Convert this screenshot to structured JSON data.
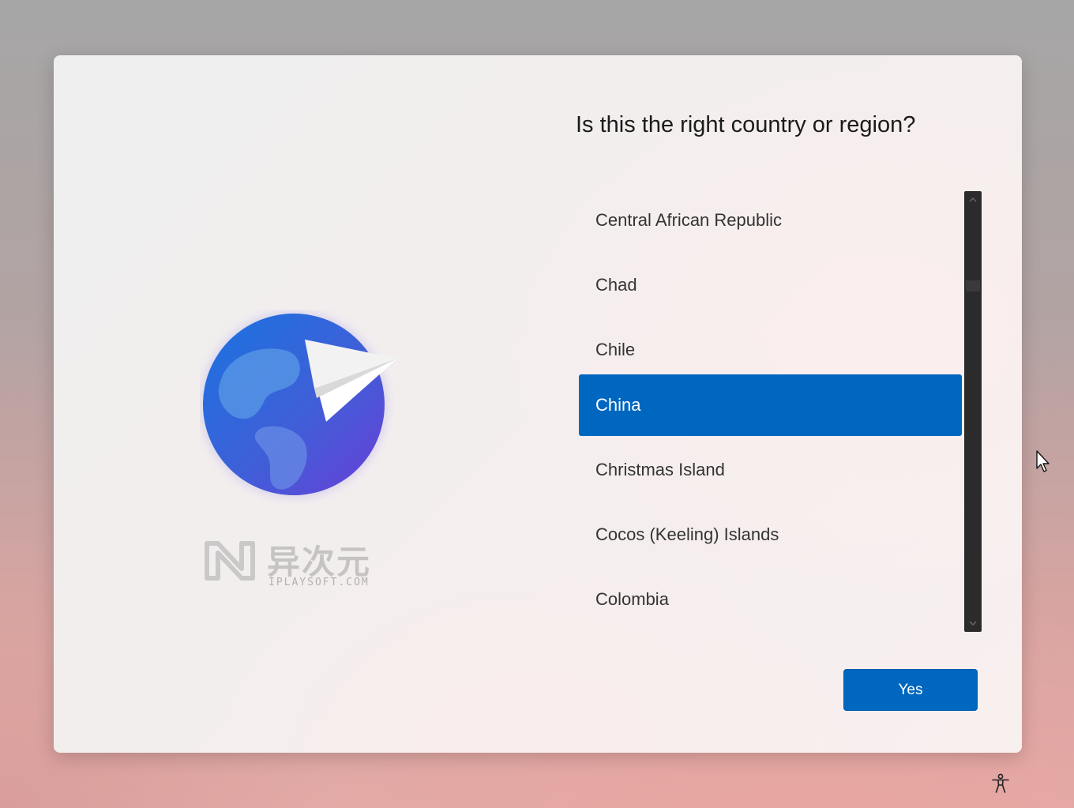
{
  "title": "Is this the right country or region?",
  "countries": [
    {
      "label": "Central African Republic",
      "selected": false
    },
    {
      "label": "Chad",
      "selected": false
    },
    {
      "label": "Chile",
      "selected": false
    },
    {
      "label": "China",
      "selected": true
    },
    {
      "label": "Christmas Island",
      "selected": false
    },
    {
      "label": "Cocos (Keeling) Islands",
      "selected": false
    },
    {
      "label": "Colombia",
      "selected": false
    }
  ],
  "yes_label": "Yes",
  "watermark": {
    "name_cn": "异次元",
    "site": "IPLAYSOFT.COM"
  },
  "icons": {
    "illustration": "globe-paper-plane-icon",
    "accessibility": "accessibility-icon",
    "scroll_up": "chevron-up-icon",
    "scroll_down": "chevron-down-icon",
    "cursor": "mouse-pointer-icon"
  },
  "colors": {
    "accent": "#0067c0",
    "scrollbar": "#2b2b2b",
    "text": "#1b1b1b"
  }
}
